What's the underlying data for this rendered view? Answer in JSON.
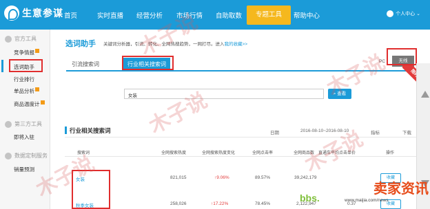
{
  "app": {
    "name": "生意参谋"
  },
  "nav": {
    "items": [
      "首页",
      "实时直播",
      "经营分析",
      "市场行情",
      "自助取数",
      "专题工具",
      "帮助中心"
    ],
    "active": "专题工具",
    "user": "个人中心 ⌄"
  },
  "sidebar": {
    "sections": [
      {
        "title": "官方工具",
        "items": [
          "竞争情报",
          "选词助手",
          "行业排行",
          "单品分析",
          "商品温度计"
        ]
      },
      {
        "title": "第三方工具",
        "items": [
          "即将入驻"
        ]
      },
      {
        "title": "数据定制服务",
        "items": [
          "销量预测"
        ]
      }
    ],
    "selected": "选词助手"
  },
  "main": {
    "title": "选词助手",
    "desc": "关键词分析器，引流、转化、全网热搜趋势，一网打尽。进入",
    "desc_link": "我的收藏>>",
    "tabs": [
      "引流搜索词",
      "行业相关搜索词"
    ],
    "tab_active": "行业相关搜索词",
    "device": {
      "pc": "PC",
      "wireless": "无线"
    },
    "ribbon": "限时体验",
    "search": {
      "value": "女装",
      "button": "查看"
    }
  },
  "section": {
    "title": "行业相关搜索词",
    "date_label": "日期",
    "date_range": "2016-08-10~2016-08-10",
    "metric_label": "指标",
    "download": "下载"
  },
  "table": {
    "headers": [
      "搜索词",
      "全网搜索热度",
      "全网搜索热度变化",
      "全网点击率",
      "全网商品数",
      "直通车平均点击单价",
      "操作"
    ],
    "rows": [
      {
        "term": "女装",
        "heat": "821,015",
        "heat_change": "↑9.06%",
        "ctr": "89.57%",
        "items": "39,242,179",
        "cpc": "",
        "op": "收藏"
      },
      {
        "term": "秋季女装",
        "heat": "258,026",
        "heat_change": "↑17.22%",
        "ctr": "78.45%",
        "items": "2,122,947",
        "cpc": "0.37",
        "op": "收藏"
      }
    ]
  },
  "watermarks": {
    "text": "木子说",
    "brand": "卖家资讯",
    "brand_sub": "bbs.",
    "brand_url": "www.maijia.com/news"
  },
  "colors": {
    "accent": "#1b9bd8",
    "nav_active": "#f5b81e",
    "highlight": "#e02d2d"
  }
}
